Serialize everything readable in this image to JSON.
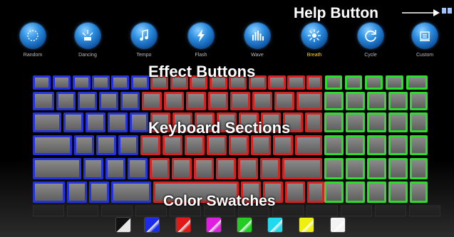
{
  "effects": [
    {
      "label": "Random",
      "icon": "random-icon",
      "active": false
    },
    {
      "label": "Dancing",
      "icon": "dancing-icon",
      "active": false
    },
    {
      "label": "Tempo",
      "icon": "music-note-icon",
      "active": false
    },
    {
      "label": "Flash",
      "icon": "lightning-icon",
      "active": false
    },
    {
      "label": "Wave",
      "icon": "wave-bars-icon",
      "active": false
    },
    {
      "label": "Breath",
      "icon": "breath-icon",
      "active": true
    },
    {
      "label": "Cycle",
      "icon": "cycle-icon",
      "active": false
    },
    {
      "label": "Custom",
      "icon": "custom-icon",
      "active": false
    }
  ],
  "annotations": {
    "help_button": "Help Button",
    "effect_buttons": "Effect Buttons",
    "keyboard_sections": "Keyboard Sections",
    "color_swatches": "Color Swatches"
  },
  "keyboard": {
    "section_colors": {
      "left": "#2533d8",
      "middle": "#d52222",
      "right": "#2edc2e"
    }
  },
  "swatches": [
    {
      "name": "black",
      "color": "#111111"
    },
    {
      "name": "blue",
      "color": "#1c2ce8"
    },
    {
      "name": "red",
      "color": "#e01818"
    },
    {
      "name": "magenta",
      "color": "#e01ee0"
    },
    {
      "name": "green",
      "color": "#22cc22"
    },
    {
      "name": "cyan",
      "color": "#22d8ee"
    },
    {
      "name": "yellow",
      "color": "#f0f010"
    },
    {
      "name": "white",
      "color": "#f4f4f4"
    }
  ]
}
